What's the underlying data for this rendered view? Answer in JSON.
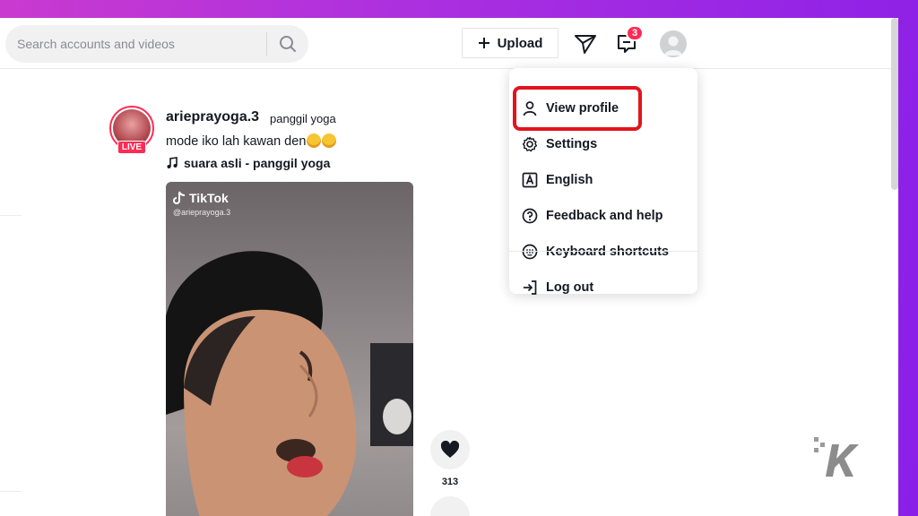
{
  "search": {
    "placeholder": "Search accounts and videos",
    "icon": "search-icon"
  },
  "header": {
    "upload_label": "Upload",
    "inbox_badge": "3"
  },
  "dropdown": {
    "items": [
      {
        "label": "View profile",
        "icon": "user-icon"
      },
      {
        "label": "Settings",
        "icon": "gear-icon"
      },
      {
        "label": "English",
        "icon": "language-icon"
      },
      {
        "label": "Feedback and help",
        "icon": "help-icon"
      },
      {
        "label": "Keyboard shortcuts",
        "icon": "keyboard-icon"
      },
      {
        "label": "Log out",
        "icon": "logout-icon"
      }
    ],
    "highlighted": "Settings",
    "highlight_color": "#e3131e"
  },
  "post": {
    "username": "arieprayoga.3",
    "nickname": "panggil yoga",
    "caption": "mode iko lah kawan den",
    "live_label": "LIVE",
    "music": "suara asli - panggil yoga",
    "watermark_brand": "TikTok",
    "watermark_handle": "@arieprayoga.3",
    "like_count": "313"
  },
  "colors": {
    "accent": "#fe2c55",
    "text": "#161823",
    "background_gradient": [
      "#c93ad0",
      "#8a1fe8"
    ]
  }
}
